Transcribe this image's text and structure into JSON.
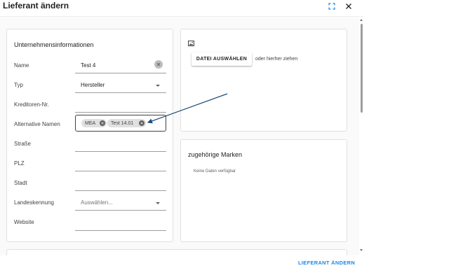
{
  "dialog": {
    "title": "Lieferant ändern",
    "icons": {
      "fullscreen": "fullscreen-icon",
      "close": "close-icon"
    }
  },
  "company": {
    "heading": "Unternehmensinformationen",
    "fields": {
      "name": {
        "label": "Name",
        "value": "Test 4"
      },
      "type": {
        "label": "Typ",
        "value": "Hersteller"
      },
      "creditor": {
        "label": "Kreditoren-Nr.",
        "value": ""
      },
      "alt_names": {
        "label": "Alternative Namen",
        "chips": [
          "MEA",
          "Test 14.01"
        ]
      },
      "street": {
        "label": "Straße",
        "value": ""
      },
      "zip": {
        "label": "PLZ",
        "value": ""
      },
      "city": {
        "label": "Stadt",
        "value": ""
      },
      "country": {
        "label": "Landeskennung",
        "placeholder": "Auswählen..."
      },
      "website": {
        "label": "Website",
        "value": ""
      }
    }
  },
  "image_upload": {
    "icon": "image-icon",
    "button_label": "DATEI AUSWÄHLEN",
    "drop_text": "oder hierher ziehen"
  },
  "brands": {
    "heading": "zugehörige Marken",
    "empty_text": "Keine Daten verfügbar"
  },
  "footer": {
    "submit_label": "LIEFERANT ÄNDERN"
  },
  "colors": {
    "accent": "#1e88e5",
    "annotation_arrow": "#1f4e79",
    "chip_bg": "#e0e0e0"
  }
}
